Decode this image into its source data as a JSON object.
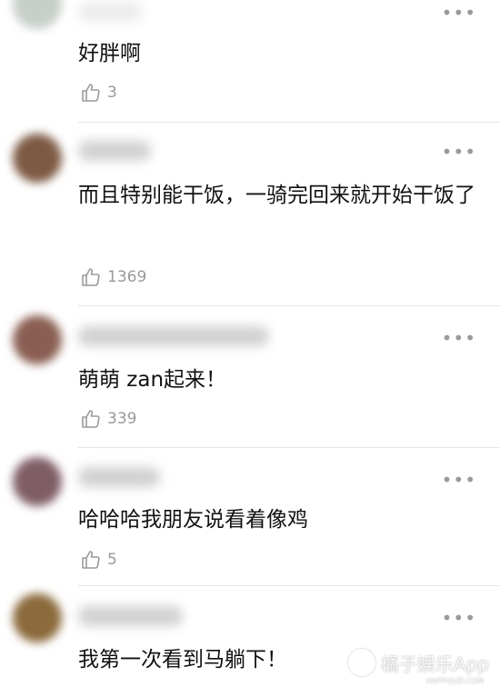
{
  "comments": [
    {
      "text": "好胖啊",
      "likes": "3",
      "avatar_color": "#c8cfc9"
    },
    {
      "text": "而且特别能干饭，一骑完回来就开始干饭了",
      "likes": "1369",
      "avatar_color": "#7d5a44"
    },
    {
      "text": "萌萌 zan起来！",
      "likes": "339",
      "avatar_color": "#8a5e52"
    },
    {
      "text": "哈哈哈我朋友说看着像鸡",
      "likes": "5",
      "avatar_color": "#7f5d66"
    },
    {
      "text": "我第一次看到马躺下！",
      "likes": "",
      "avatar_color": "#8b6a3c"
    }
  ],
  "more_icon": "more-dots-icon",
  "like_icon": "thumbs-up-icon",
  "watermark": {
    "text": "橘子娱乐App",
    "subtext": "HAPPYJUZI.COM"
  }
}
